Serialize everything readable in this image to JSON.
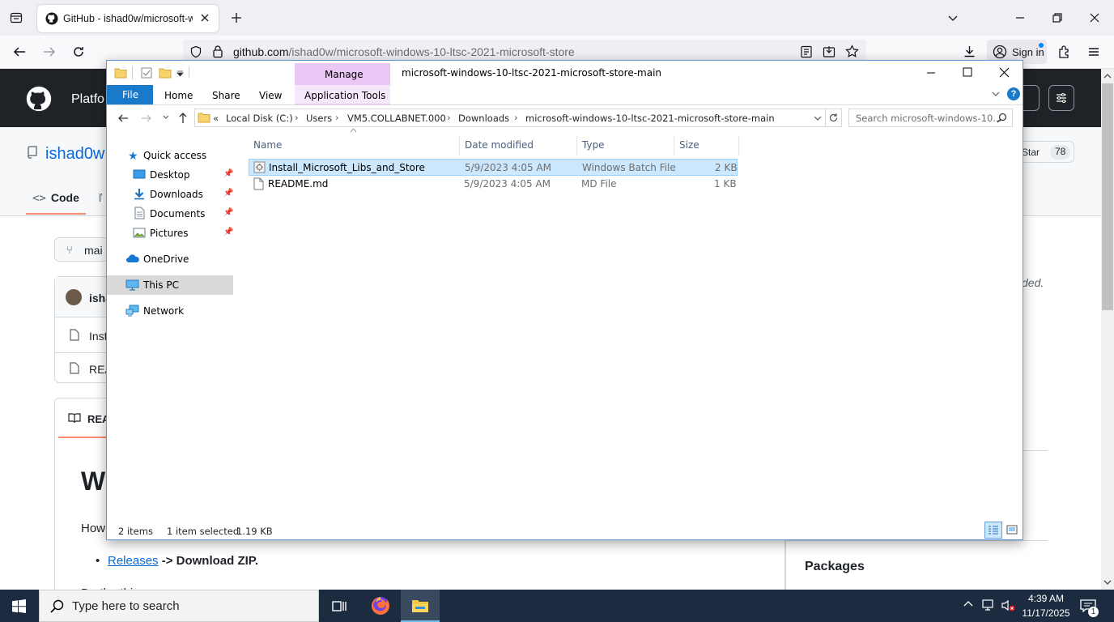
{
  "browser": {
    "tab_title": "GitHub - ishad0w/microsoft-wi",
    "url_host": "github.com",
    "url_path": "/ishad0w/microsoft-windows-10-ltsc-2021-microsoft-store",
    "signin_label": "Sign in"
  },
  "github": {
    "nav_partial": "Platfo",
    "repo_owner_partial": "ishad0w",
    "star_label": "Star",
    "star_count": "78",
    "code_tab": "Code",
    "branch_partial": "mai",
    "commit_user_partial": "isha",
    "file1_partial": "Inst",
    "file2_partial": "REA",
    "readme_tab_partial": "REA",
    "about_partial": "ded.",
    "heading_partial": "W",
    "howto_partial": "How",
    "releases_link": "Releases",
    "releases_rest": " -> Download ZIP.",
    "packages_heading": "Packages",
    "cut_text": "Do the thing"
  },
  "explorer": {
    "ribbon_manage": "Manage",
    "window_title": "microsoft-windows-10-ltsc-2021-microsoft-store-main",
    "tabs": [
      "File",
      "Home",
      "Share",
      "View",
      "Application Tools"
    ],
    "breadcrumb_prefix": "«",
    "breadcrumb": [
      "Local Disk (C:)",
      "Users",
      "VM5.COLLABNET.000",
      "Downloads",
      "microsoft-windows-10-ltsc-2021-microsoft-store-main"
    ],
    "search_placeholder": "Search microsoft-windows-10...",
    "nav": {
      "quick_access": "Quick access",
      "desktop": "Desktop",
      "downloads": "Downloads",
      "documents": "Documents",
      "pictures": "Pictures",
      "onedrive": "OneDrive",
      "this_pc": "This PC",
      "network": "Network"
    },
    "columns": [
      "Name",
      "Date modified",
      "Type",
      "Size"
    ],
    "files": [
      {
        "name": "Install_Microsoft_Libs_and_Store",
        "date": "5/9/2023 4:05 AM",
        "type": "Windows Batch File",
        "size": "2 KB",
        "selected": true
      },
      {
        "name": "README.md",
        "date": "5/9/2023 4:05 AM",
        "type": "MD File",
        "size": "1 KB",
        "selected": false
      }
    ],
    "status_items": "2 items",
    "status_selected": "1 item selected",
    "status_size": "1.19 KB"
  },
  "taskbar": {
    "search_placeholder": "Type here to search",
    "time": "4:39 AM",
    "date": "11/17/2025",
    "notification_count": "1"
  },
  "colors": {
    "gh_header": "#1f2328",
    "explorer_file_tab": "#1979ca",
    "selection": "#cce8ff",
    "manage_tab": "#e9c8f5",
    "taskbar": "#1c2b3f"
  }
}
